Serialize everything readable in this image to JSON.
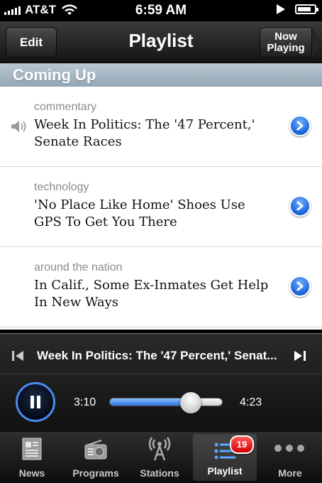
{
  "status_bar": {
    "carrier": "AT&T",
    "time": "6:59 AM",
    "battery_level": 0.85
  },
  "nav": {
    "edit_label": "Edit",
    "title": "Playlist",
    "now_playing_line1": "Now",
    "now_playing_line2": "Playing"
  },
  "section": {
    "title": "Coming Up"
  },
  "list": {
    "items": [
      {
        "category": "commentary",
        "title": "Week In Politics: The '47 Percent,' Senate Races"
      },
      {
        "category": "technology",
        "title": "'No Place Like Home' Shoes Use GPS To Get You There"
      },
      {
        "category": "around the nation",
        "title": "In Calif., Some Ex-Inmates Get Help In New Ways"
      }
    ]
  },
  "player": {
    "track_title": "Week In Politics: The '47 Percent,' Senat...",
    "elapsed": "3:10",
    "duration": "4:23",
    "progress": 0.72
  },
  "tabs": [
    {
      "label": "News",
      "icon": "news-icon"
    },
    {
      "label": "Programs",
      "icon": "radio-icon"
    },
    {
      "label": "Stations",
      "icon": "antenna-icon"
    },
    {
      "label": "Playlist",
      "icon": "playlist-icon",
      "badge": "19"
    },
    {
      "label": "More",
      "icon": "more-icon"
    }
  ],
  "colors": {
    "accent_blue": "#2b6fe0",
    "badge_red": "#d10000",
    "section_header": "#a6b5c1"
  }
}
